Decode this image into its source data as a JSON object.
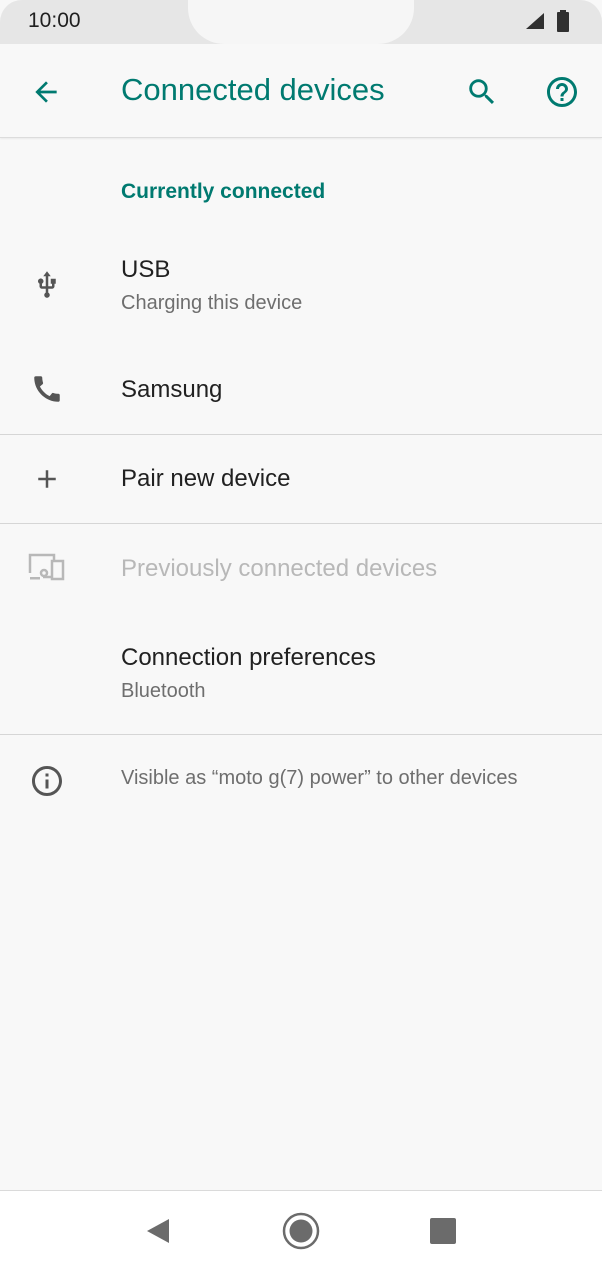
{
  "status_bar": {
    "time": "10:00"
  },
  "app_bar": {
    "title": "Connected devices"
  },
  "sections": {
    "currently_connected": "Currently connected"
  },
  "items": {
    "usb": {
      "title": "USB",
      "subtitle": "Charging this device"
    },
    "samsung": {
      "title": "Samsung"
    },
    "pair_new": {
      "title": "Pair new device"
    },
    "previously_connected": {
      "title": "Previously connected devices"
    },
    "connection_prefs": {
      "title": "Connection preferences",
      "subtitle": "Bluetooth"
    }
  },
  "info": {
    "text": "Visible as “moto g(7) power” to other devices"
  },
  "colors": {
    "accent": "#007a70",
    "background": "#f8f8f8",
    "icon": "#555555"
  }
}
